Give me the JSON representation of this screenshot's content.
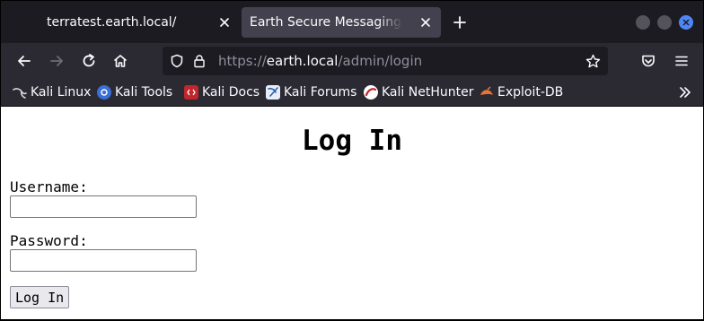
{
  "browser": {
    "tabs": [
      {
        "title": "terratest.earth.local/",
        "active": false
      },
      {
        "title": "Earth Secure Messaging Admin",
        "active": true
      }
    ],
    "url": {
      "scheme": "https://",
      "host": "earth.local",
      "path": "/admin/login"
    },
    "bookmarks": [
      {
        "label": "Kali Linux",
        "icon": "kali-dragon-icon"
      },
      {
        "label": "Kali Tools",
        "icon": "kali-tools-icon"
      },
      {
        "label": "Kali Docs",
        "icon": "kali-docs-icon"
      },
      {
        "label": "Kali Forums",
        "icon": "kali-forums-icon"
      },
      {
        "label": "Kali NetHunter",
        "icon": "kali-nethunter-icon"
      },
      {
        "label": "Exploit-DB",
        "icon": "exploit-db-icon"
      }
    ],
    "colors": {
      "tabstrip_bg": "#1c1b22",
      "toolbar_bg": "#2b2a33",
      "active_tab_bg": "#42414d",
      "accent": "#4f86f7"
    }
  },
  "page": {
    "heading": "Log In",
    "username_label": "Username:",
    "username_value": "",
    "password_label": "Password:",
    "password_value": "",
    "submit_label": "Log In"
  }
}
